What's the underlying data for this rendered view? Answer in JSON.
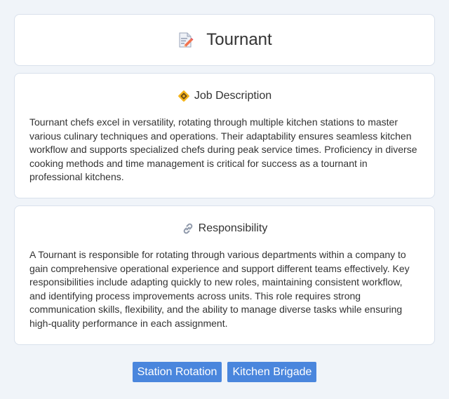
{
  "header": {
    "title": "Tournant",
    "icon": "memo-pencil-icon"
  },
  "sections": [
    {
      "icon": "badge-icon",
      "title": "Job Description",
      "body": "Tournant chefs excel in versatility, rotating through multiple kitchen stations to master various culinary techniques and operations. Their adaptability ensures seamless kitchen workflow and supports specialized chefs during peak service times. Proficiency in diverse cooking methods and time management is critical for success as a tournant in professional kitchens."
    },
    {
      "icon": "link-icon",
      "title": "Responsibility",
      "body": "A Tournant is responsible for rotating through various departments within a company to gain comprehensive operational experience and support different teams effectively. Key responsibilities include adapting quickly to new roles, maintaining consistent workflow, and identifying process improvements across units. This role requires strong communication skills, flexibility, and the ability to manage diverse tasks while ensuring high-quality performance in each assignment."
    }
  ],
  "tags": [
    "Station Rotation",
    "Kitchen Brigade"
  ],
  "colors": {
    "background": "#f0f4f9",
    "card": "#ffffff",
    "tag": "#4a86dd",
    "text": "#333333"
  }
}
